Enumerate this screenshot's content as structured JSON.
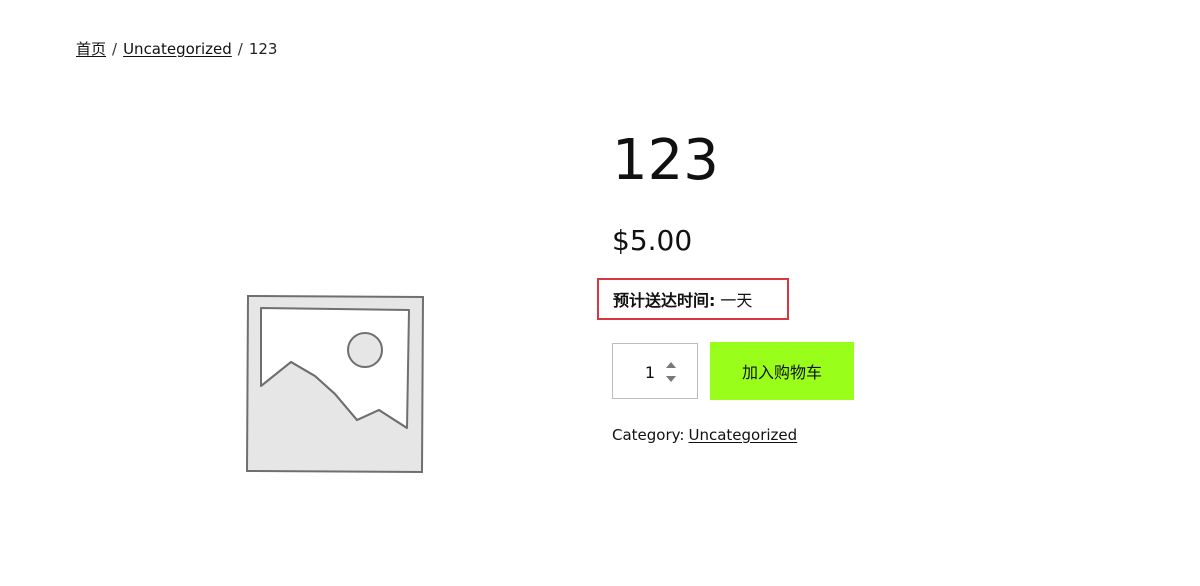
{
  "breadcrumb": {
    "items": [
      {
        "label": "首页"
      },
      {
        "label": "Uncategorized"
      }
    ],
    "current": "123",
    "separator": "/"
  },
  "product": {
    "image_icon": "image-placeholder-icon",
    "title": "123",
    "price": "$5.00",
    "delivery": {
      "label": "预计送达时间:",
      "value": "一天",
      "highlight_color": "#d9363e"
    },
    "quantity": "1",
    "add_to_cart_label": "加入购物车",
    "button_color": "#99ff1a",
    "category": {
      "label": "Category:",
      "value": "Uncategorized"
    }
  }
}
